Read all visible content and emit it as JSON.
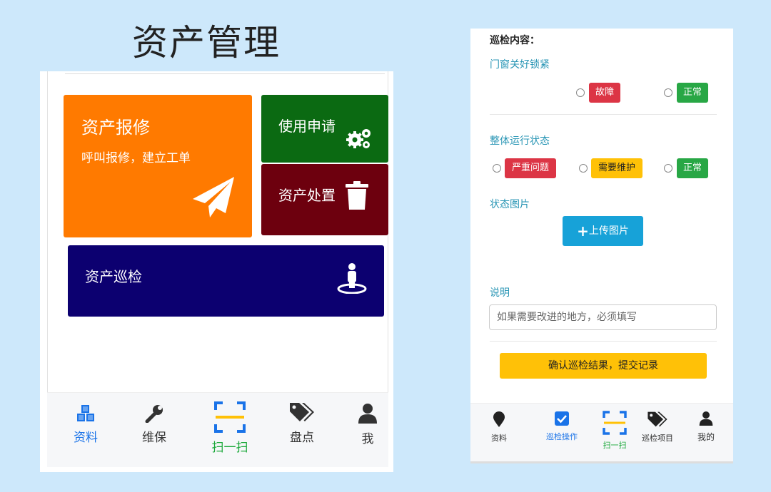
{
  "heading": "资产管理",
  "left": {
    "tiles": {
      "repair": {
        "title": "资产报修",
        "subtitle": "呼叫报修，建立工单"
      },
      "apply": {
        "title": "使用申请"
      },
      "dispose": {
        "title": "资产处置"
      },
      "inspect": {
        "title": "资产巡检"
      }
    },
    "tabs": [
      {
        "label": "资料",
        "icon": "cubes-icon"
      },
      {
        "label": "维保",
        "icon": "wrench-icon"
      },
      {
        "label": "扫一扫",
        "icon": "scan-icon"
      },
      {
        "label": "盘点",
        "icon": "tags-icon"
      },
      {
        "label": "我",
        "icon": "user-icon"
      }
    ]
  },
  "right": {
    "section_title": "巡检内容：",
    "items": [
      {
        "label": "门窗关好锁紧",
        "options": [
          "故障",
          "正常"
        ]
      },
      {
        "label": "整体运行状态",
        "options": [
          "严重问题",
          "需要维护",
          "正常"
        ]
      }
    ],
    "photo_label": "状态图片",
    "upload_label": "上传图片",
    "desc_label": "说明",
    "desc_placeholder": "如果需要改进的地方，必须填写",
    "confirm_label": "确认巡检结果，提交记录",
    "tabs": [
      {
        "label": "资料",
        "icon": "map-marker-icon"
      },
      {
        "label": "巡检操作",
        "icon": "checkbox-icon"
      },
      {
        "label": "扫一扫",
        "icon": "scan-icon"
      },
      {
        "label": "巡检项目",
        "icon": "tags-icon"
      },
      {
        "label": "我的",
        "icon": "user-icon"
      }
    ]
  },
  "colors": {
    "background": "#cde8fb",
    "repair": "#ff7a00",
    "apply": "#0b6a12",
    "dispose": "#6d000e",
    "inspect": "#0c0070",
    "active_tab": "#1a73e8",
    "scan_active": "#1aa839",
    "danger": "#dc3545",
    "success": "#28a745",
    "warning": "#ffc107",
    "info": "#17a2d8"
  }
}
